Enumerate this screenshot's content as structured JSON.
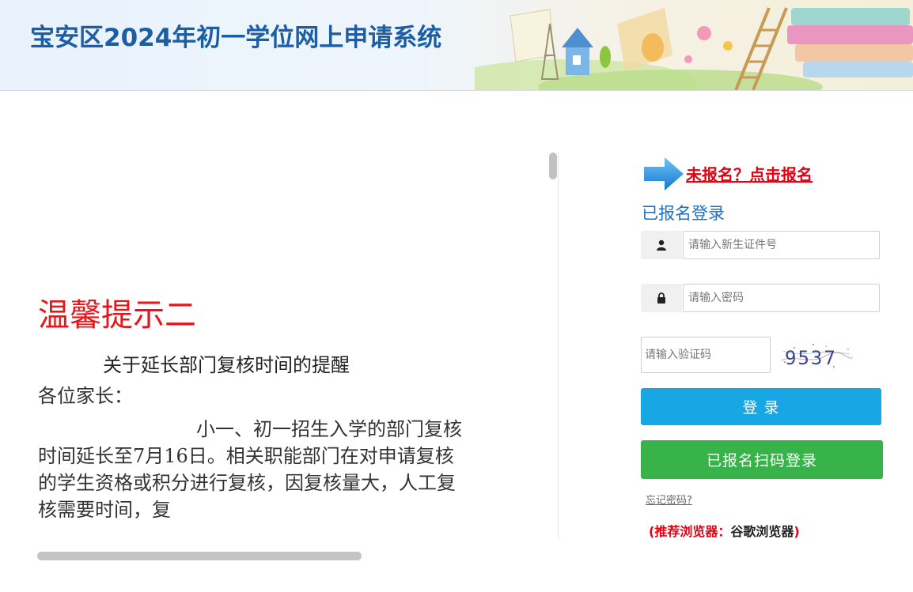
{
  "header": {
    "title": "宝安区2024年初一学位网上申请系统"
  },
  "notice": {
    "title": "温馨提示二",
    "subtitle": "关于延长部门复核时间的提醒",
    "greeting": "各位家长：",
    "body": "小一、初一招生入学的部门复核时间延长至7月16日。相关职能部门在对申请复核的学生资格或积分进行复核，因复核量大，人工复核需要时间，复"
  },
  "login": {
    "signup_link": "未报名？点击报名",
    "heading": "已报名登录",
    "id_placeholder": "请输入新生证件号",
    "password_placeholder": "请输入密码",
    "captcha_placeholder": "请输入验证码",
    "captcha_text": "9537",
    "login_button": "登 录",
    "qr_login_button": "已报名扫码登录",
    "forgot_password": "忘记密码?",
    "browser_tip_open": "(推荐浏览器：",
    "browser_tip_name": "谷歌浏览器",
    "browser_tip_close": ")"
  },
  "icons": {
    "user": "user-icon",
    "lock": "lock-icon",
    "arrow": "arrow-right-icon"
  },
  "colors": {
    "title_blue": "#1c5ea3",
    "alert_red": "#e60012",
    "login_blue": "#18a7e5",
    "qr_green": "#37b34a"
  }
}
